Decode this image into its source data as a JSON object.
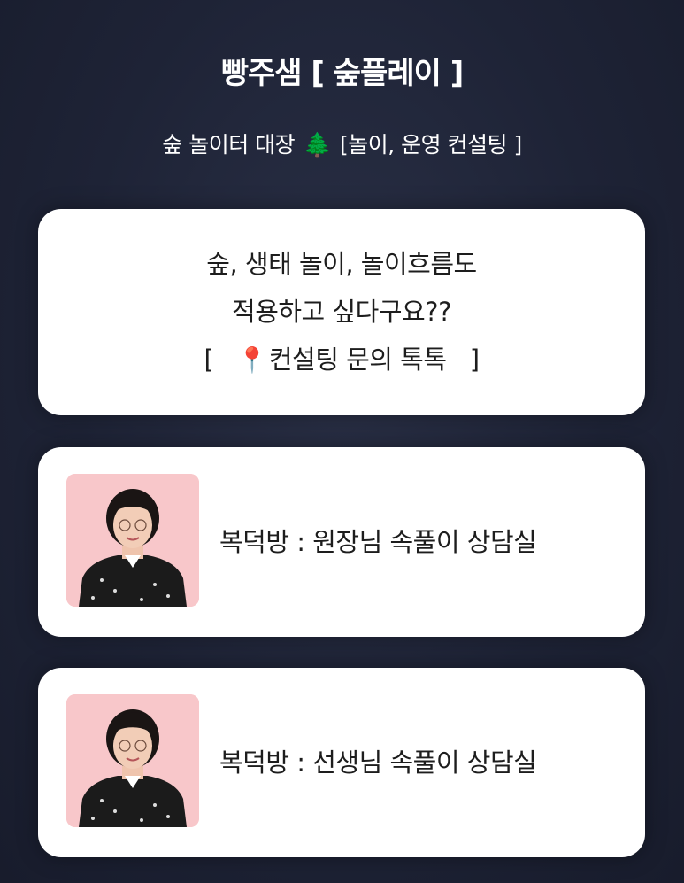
{
  "header": {
    "title": "빵주샘 [ 숲플레이 ]",
    "subtitle_before": "숲 놀이터 대장",
    "subtitle_after": "[놀이, 운영 컨설팅 ]",
    "tree_icon": "evergreen-tree-icon"
  },
  "cards": {
    "consult": {
      "line1": "숲, 생태 놀이, 놀이흐름도",
      "line2": "적용하고 싶다구요??",
      "line3_open": "[",
      "line3_text": "컨설팅 문의  톡톡",
      "line3_close": "]",
      "pin_icon": "round-pushpin-icon"
    },
    "profile1": {
      "label": "복덕방 : 원장님 속풀이 상담실"
    },
    "profile2": {
      "label": "복덕방 : 선생님 속풀이 상담실"
    }
  },
  "colors": {
    "background": "#1e2336",
    "card": "#ffffff",
    "avatar_background": "#f8c7ca"
  }
}
